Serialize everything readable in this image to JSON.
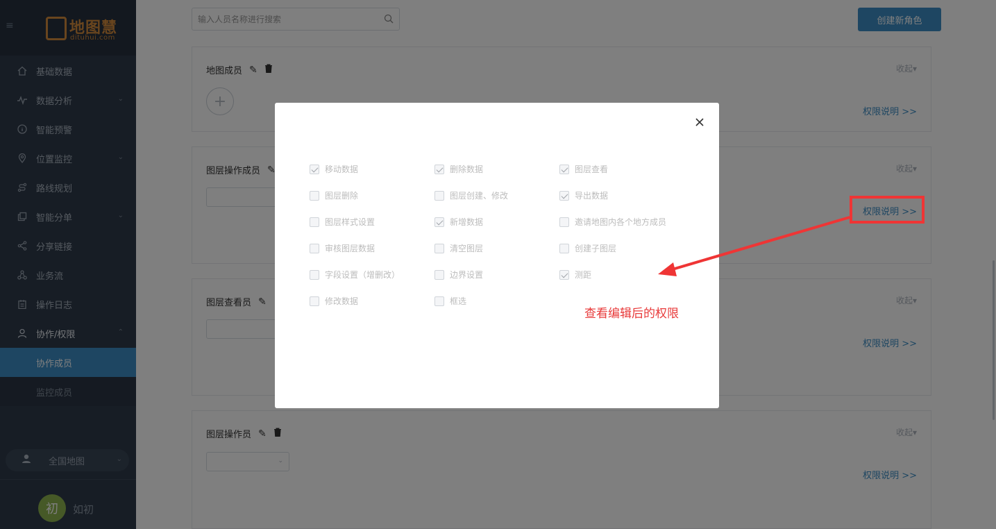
{
  "sidebar": {
    "logo_text": "地图慧",
    "logo_sub": "dituhui.com",
    "items": [
      {
        "label": "基础数据",
        "icon": "home-icon"
      },
      {
        "label": "数据分析",
        "icon": "activity-icon"
      },
      {
        "label": "智能预警",
        "icon": "info-icon"
      },
      {
        "label": "位置监控",
        "icon": "location-pin-icon"
      },
      {
        "label": "路线规划",
        "icon": "route-icon"
      },
      {
        "label": "智能分单",
        "icon": "copy-icon"
      },
      {
        "label": "分享链接",
        "icon": "share-icon"
      },
      {
        "label": "业务流",
        "icon": "flow-icon"
      },
      {
        "label": "操作日志",
        "icon": "clipboard-icon"
      },
      {
        "label": "协作/权限",
        "icon": "user-icon"
      }
    ],
    "subitems": [
      {
        "label": "协作成员",
        "active": true
      },
      {
        "label": "监控成员",
        "active": false
      }
    ],
    "map_select": "全国地图",
    "user": {
      "avatar_char": "初",
      "name": "如初"
    }
  },
  "main": {
    "search_placeholder": "输入人员名称进行搜索",
    "create_button": "创建新角色",
    "cards": [
      {
        "title": "地图成员",
        "collapse": "收起",
        "perm_link": "权限说明 >>"
      },
      {
        "title": "图层操作成员",
        "collapse": "收起",
        "perm_link": "权限说明 >>"
      },
      {
        "title": "图层查看员",
        "collapse": "收起",
        "perm_link": "权限说明 >>"
      },
      {
        "title": "图层操作员",
        "collapse": "收起",
        "perm_link": "权限说明 >>"
      }
    ]
  },
  "modal": {
    "permissions": [
      {
        "label": "移动数据",
        "checked": true
      },
      {
        "label": "删除数据",
        "checked": true
      },
      {
        "label": "图层查看",
        "checked": true
      },
      {
        "label": "图层删除",
        "checked": false
      },
      {
        "label": "图层创建、修改",
        "checked": false
      },
      {
        "label": "导出数据",
        "checked": true
      },
      {
        "label": "图层样式设置",
        "checked": false
      },
      {
        "label": "新增数据",
        "checked": true
      },
      {
        "label": "邀请地图内各个地方成员",
        "checked": false
      },
      {
        "label": "审核图层数据",
        "checked": false
      },
      {
        "label": "清空图层",
        "checked": false
      },
      {
        "label": "创建子图层",
        "checked": false
      },
      {
        "label": "字段设置（增删改）",
        "checked": false
      },
      {
        "label": "边界设置",
        "checked": false
      },
      {
        "label": "测距",
        "checked": true
      },
      {
        "label": "修改数据",
        "checked": false
      },
      {
        "label": "框选",
        "checked": false
      }
    ]
  },
  "annotation": {
    "text": "查看编辑后的权限",
    "color": "#e83a3a"
  },
  "colors": {
    "sidebar_bg": "#2f3b4b",
    "accent": "#3c8dc4",
    "logo": "#d28a3c"
  }
}
